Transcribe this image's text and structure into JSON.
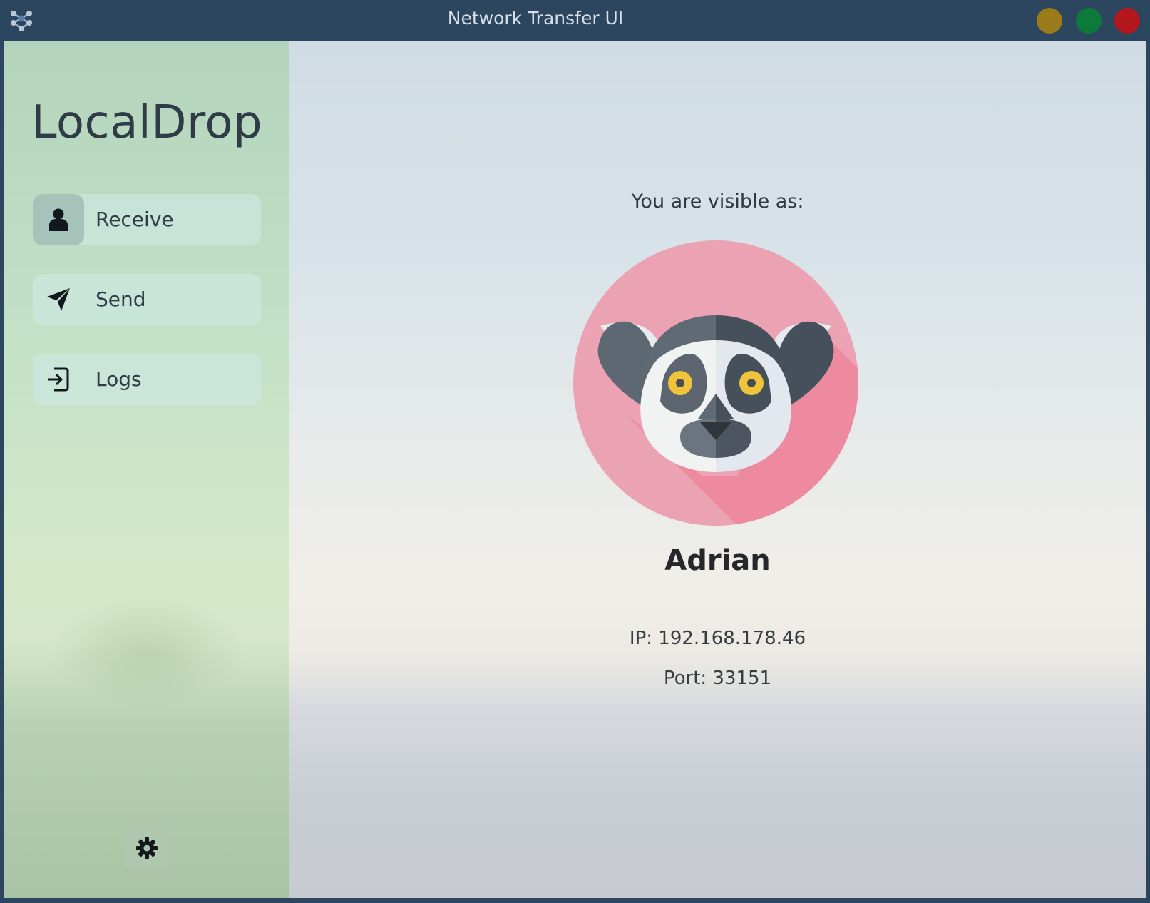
{
  "window": {
    "title": "Network Transfer UI",
    "buttons": {
      "minimize_color": "#9b7a1a",
      "maximize_color": "#0c7a3b",
      "close_color": "#b3161d"
    }
  },
  "sidebar": {
    "brand": "LocalDrop",
    "items": [
      {
        "label": "Receive",
        "icon": "person-icon",
        "active": true
      },
      {
        "label": "Send",
        "icon": "paper-plane-icon",
        "active": false
      },
      {
        "label": "Logs",
        "icon": "login-icon",
        "active": false
      }
    ],
    "settings_icon": "gear-icon"
  },
  "main": {
    "visible_label": "You are visible as:",
    "avatar": "lemur-avatar",
    "device_name": "Adrian",
    "ip": "IP: 192.168.178.46",
    "port": "Port: 33151"
  }
}
